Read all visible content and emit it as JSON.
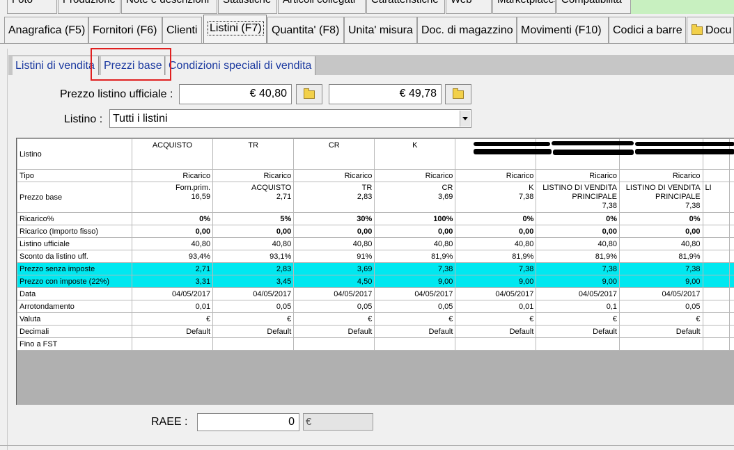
{
  "top_tabs": [
    "Foto",
    "Produzione",
    "Note e descrizioni",
    "Statistiche",
    "Articoli collegati",
    "Caratteristiche",
    "Web",
    "Marketplaces",
    "Compatibilità"
  ],
  "main_tabs": [
    "Anagrafica (F5)",
    "Fornitori (F6)",
    "Clienti",
    "Listini (F7)",
    "Quantita' (F8)",
    "Unita' misura",
    "Doc. di magazzino",
    "Movimenti (F10)",
    "Codici a barre",
    "Docu"
  ],
  "sub_tabs": [
    "Listini di vendita",
    "Prezzi base",
    "Condizioni speciali di vendita"
  ],
  "prezzo_listino": {
    "label": "Prezzo listino ufficiale :",
    "value1": "€ 40,80",
    "value2": "€ 49,78"
  },
  "listino": {
    "label": "Listino :",
    "selected": "Tutti i listini"
  },
  "grid": {
    "header_label": "Listino",
    "columns": [
      "ACQUISTO",
      "TR",
      "CR",
      "K",
      "",
      "",
      "",
      ""
    ],
    "rows": [
      {
        "label": "Tipo",
        "values": [
          "Ricarico",
          "Ricarico",
          "Ricarico",
          "Ricarico",
          "Ricarico",
          "Ricarico",
          "Ricarico",
          ""
        ]
      },
      {
        "label": "Prezzo base",
        "values": [
          [
            "Forn.prim.",
            "16,59"
          ],
          [
            "ACQUISTO",
            "2,71"
          ],
          [
            "TR",
            "2,83"
          ],
          [
            "CR",
            "3,69"
          ],
          [
            "K",
            "7,38"
          ],
          [
            "LISTINO DI VENDITA",
            "PRINCIPALE",
            "7,38"
          ],
          [
            "LISTINO DI VENDITA",
            "PRINCIPALE",
            "7,38"
          ],
          [
            "LI"
          ]
        ]
      },
      {
        "label": "Ricarico%",
        "values": [
          "0%",
          "5%",
          "30%",
          "100%",
          "0%",
          "0%",
          "0%",
          ""
        ]
      },
      {
        "label": "Ricarico (Importo fisso)",
        "values": [
          "0,00",
          "0,00",
          "0,00",
          "0,00",
          "0,00",
          "0,00",
          "0,00",
          ""
        ]
      },
      {
        "label": "Listino ufficiale",
        "values": [
          "40,80",
          "40,80",
          "40,80",
          "40,80",
          "40,80",
          "40,80",
          "40,80",
          ""
        ]
      },
      {
        "label": "Sconto da listino uff.",
        "values": [
          "93,4%",
          "93,1%",
          "91%",
          "81,9%",
          "81,9%",
          "81,9%",
          "81,9%",
          ""
        ]
      },
      {
        "label": "Prezzo senza imposte",
        "values": [
          "2,71",
          "2,83",
          "3,69",
          "7,38",
          "7,38",
          "7,38",
          "7,38",
          ""
        ]
      },
      {
        "label": "Prezzo con imposte (22%)",
        "values": [
          "3,31",
          "3,45",
          "4,50",
          "9,00",
          "9,00",
          "9,00",
          "9,00",
          ""
        ]
      },
      {
        "label": "Data",
        "values": [
          "04/05/2017",
          "04/05/2017",
          "04/05/2017",
          "04/05/2017",
          "04/05/2017",
          "04/05/2017",
          "04/05/2017",
          ""
        ]
      },
      {
        "label": "Arrotondamento",
        "values": [
          "0,01",
          "0,05",
          "0,05",
          "0,05",
          "0,01",
          "0,1",
          "0,05",
          ""
        ]
      },
      {
        "label": "Valuta",
        "values": [
          "€",
          "€",
          "€",
          "€",
          "€",
          "€",
          "€",
          ""
        ]
      },
      {
        "label": "Decimali",
        "values": [
          "Default",
          "Default",
          "Default",
          "Default",
          "Default",
          "Default",
          "Default",
          ""
        ]
      },
      {
        "label": "Fino a FST",
        "values": [
          "",
          "",
          "",
          "",
          "",
          "",
          "",
          ""
        ]
      }
    ]
  },
  "raee": {
    "label": "RAEE :",
    "value": "0",
    "unit": "€"
  },
  "colors": {
    "highlight_row": "#00e8f0",
    "selection_box": "#e02020",
    "link_text": "#1c3aa0"
  }
}
